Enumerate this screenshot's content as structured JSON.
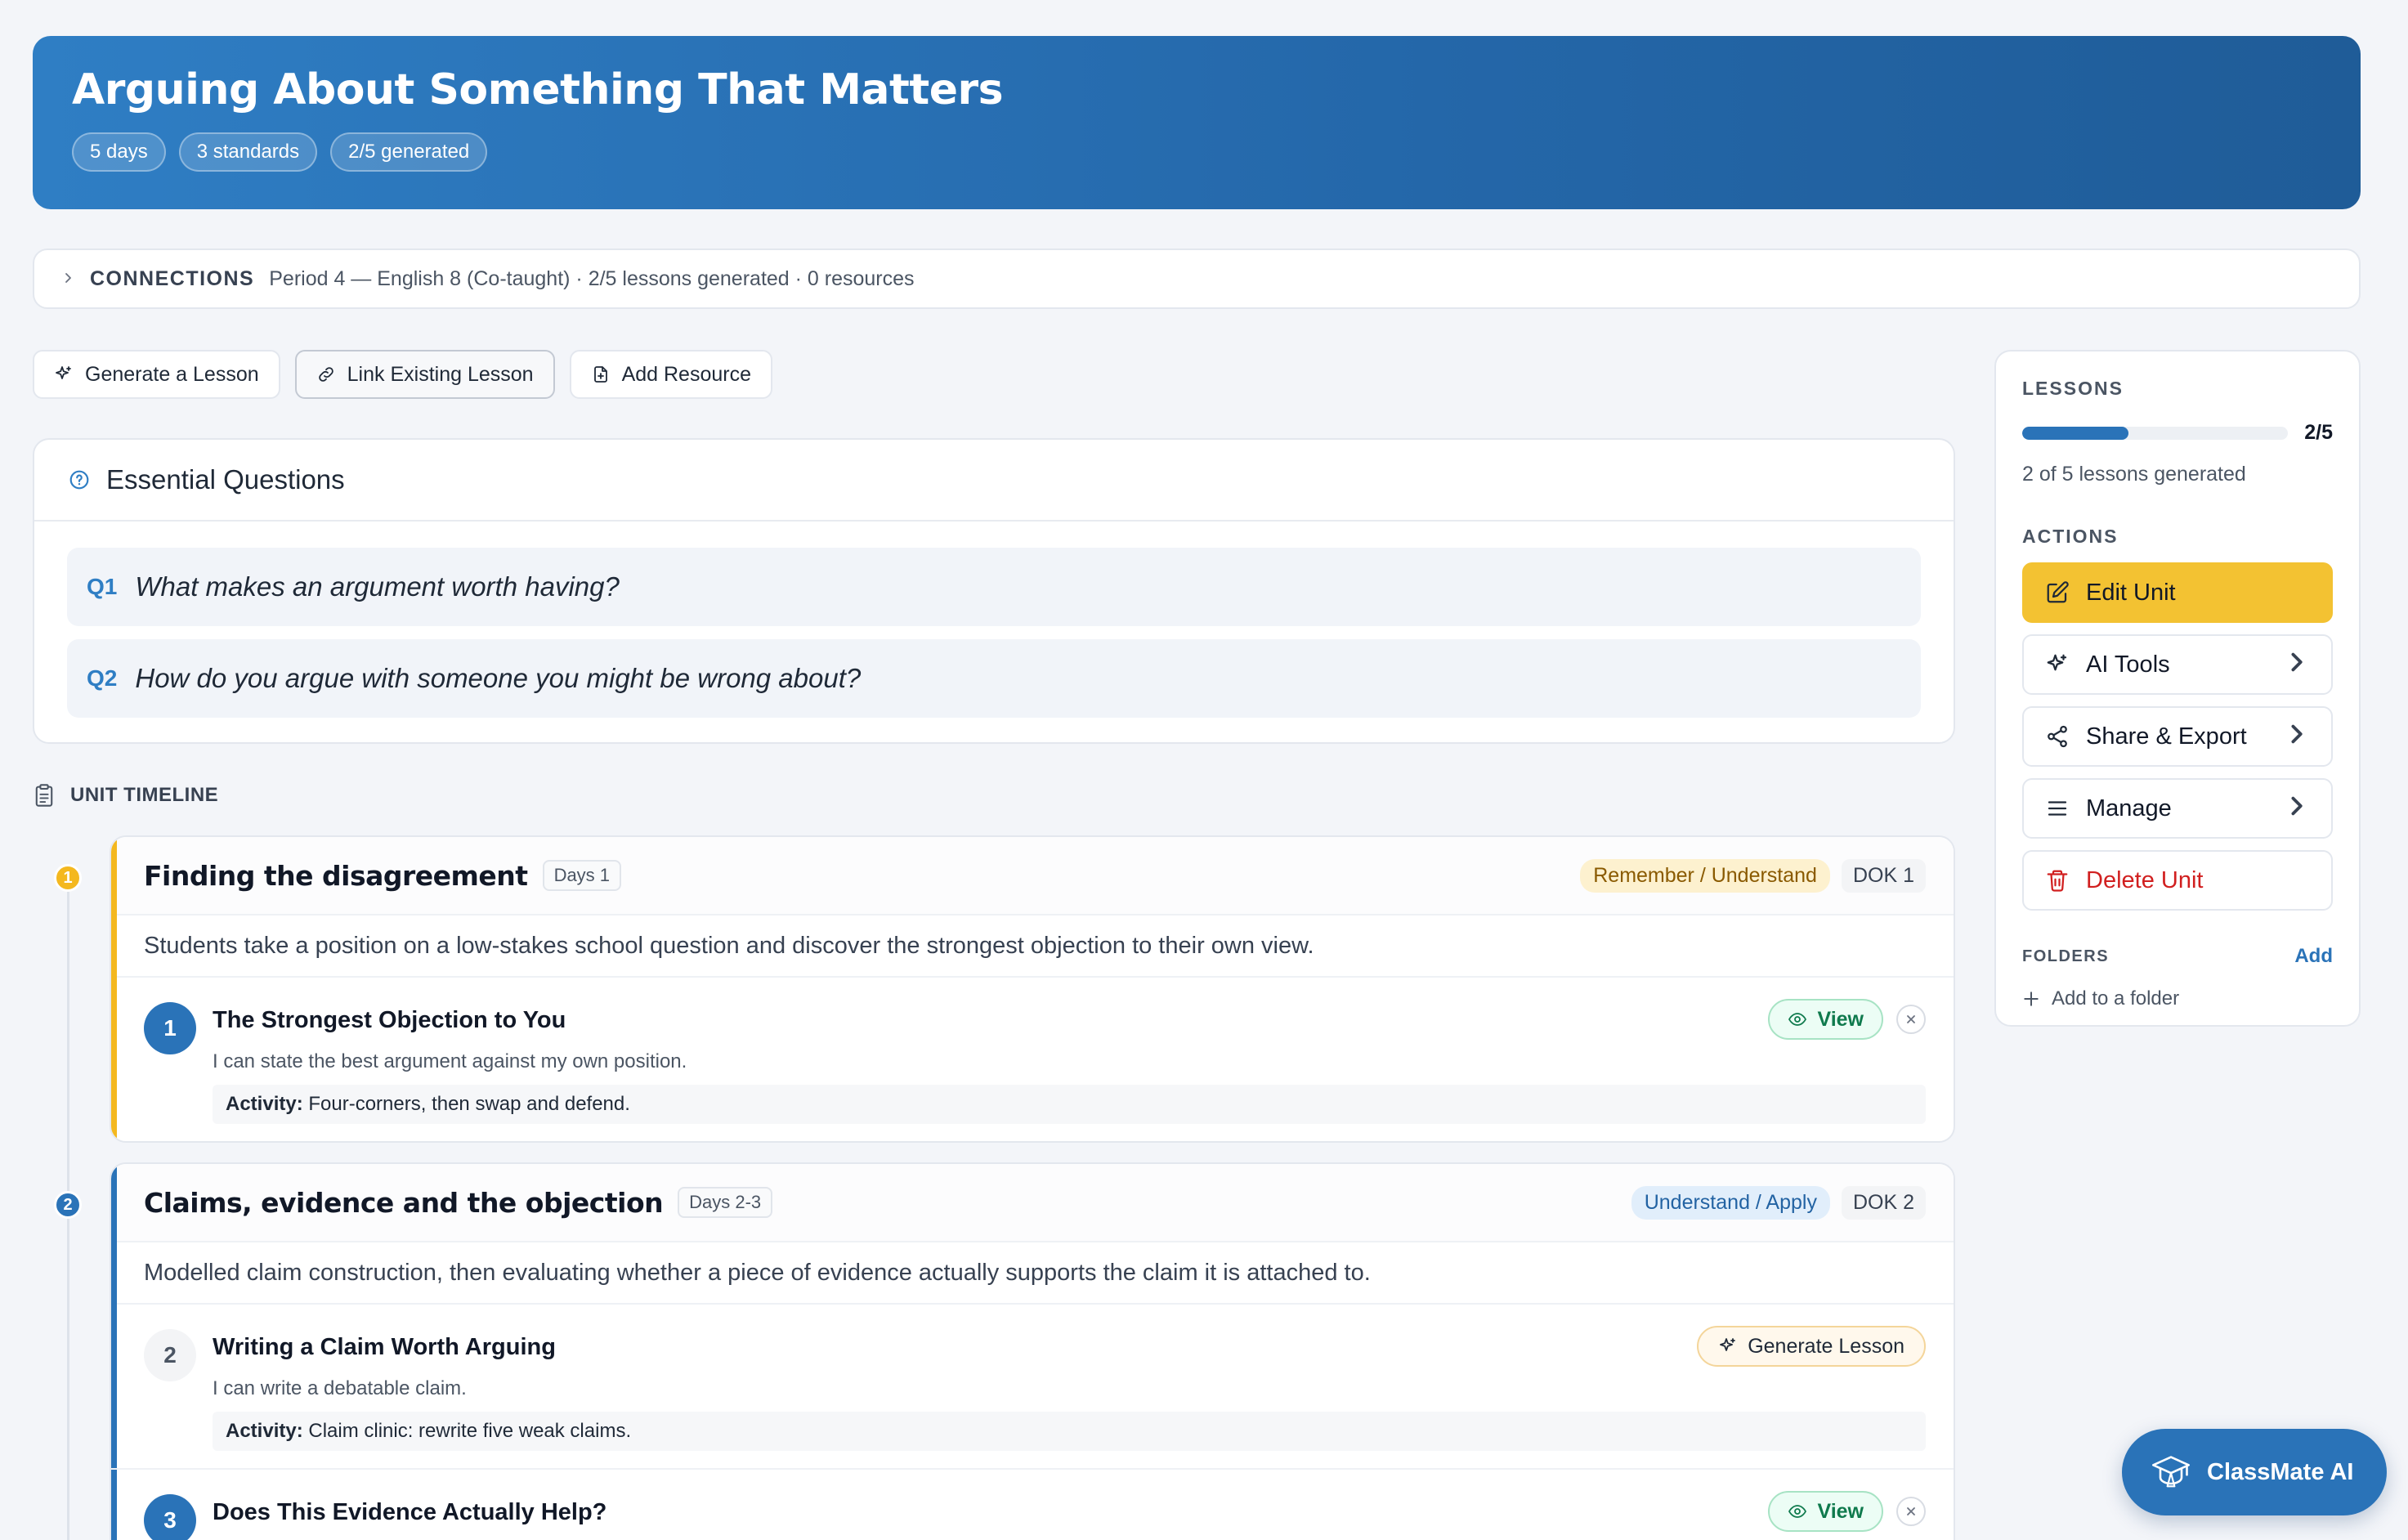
{
  "unit": {
    "title": "Arguing About Something That Matters",
    "chips": [
      "5 days",
      "3 standards",
      "2/5 generated"
    ]
  },
  "connections": {
    "label": "CONNECTIONS",
    "summary": "Period 4 — English 8 (Co-taught) · 2/5 lessons generated · 0 resources"
  },
  "toolbar": {
    "generate": "Generate a Lesson",
    "link": "Link Existing Lesson",
    "resource": "Add Resource"
  },
  "essential_questions": {
    "title": "Essential Questions",
    "items": [
      {
        "num": "Q1",
        "text": "What makes an argument worth having?"
      },
      {
        "num": "Q2",
        "text": "How do you argue with someone you might be wrong about?"
      }
    ]
  },
  "timeline": {
    "title": "UNIT TIMELINE",
    "phases": [
      {
        "num": "1",
        "title": "Finding the disagreement",
        "days": "Days 1",
        "bloom": "Remember / Understand",
        "dok": "DOK 1",
        "color": "#f4b81f",
        "desc": "Students take a position on a low-stakes school question and discover the strongest objection to their own view.",
        "lessons": [
          {
            "num": "1",
            "title": "The Strongest Objection to You",
            "objective": "I can state the best argument against my own position.",
            "activity_label": "Activity:",
            "activity": "Four-corners, then swap and defend.",
            "action": "View"
          }
        ]
      },
      {
        "num": "2",
        "title": "Claims, evidence and the objection",
        "days": "Days 2-3",
        "bloom": "Understand / Apply",
        "dok": "DOK 2",
        "color": "#2a73b8",
        "desc": "Modelled claim construction, then evaluating whether a piece of evidence actually supports the claim it is attached to.",
        "lessons": [
          {
            "num": "2",
            "title": "Writing a Claim Worth Arguing",
            "objective": "I can write a debatable claim.",
            "activity_label": "Activity:",
            "activity": "Claim clinic: rewrite five weak claims.",
            "action": "Generate Lesson"
          },
          {
            "num": "3",
            "title": "Does This Evidence Actually Help?",
            "action": "View"
          }
        ]
      }
    ]
  },
  "sidebar": {
    "lessons_label": "LESSONS",
    "progress": {
      "generated": 2,
      "total": 5,
      "ratio": "2/5",
      "text": "2 of 5 lessons generated"
    },
    "actions_label": "ACTIONS",
    "actions": {
      "edit": "Edit Unit",
      "ai": "AI Tools",
      "share": "Share & Export",
      "manage": "Manage",
      "delete": "Delete Unit"
    },
    "folders_label": "FOLDERS",
    "folders_add": "Add",
    "add_folder": "Add to a folder"
  },
  "assistant": {
    "label": "ClassMate AI"
  }
}
